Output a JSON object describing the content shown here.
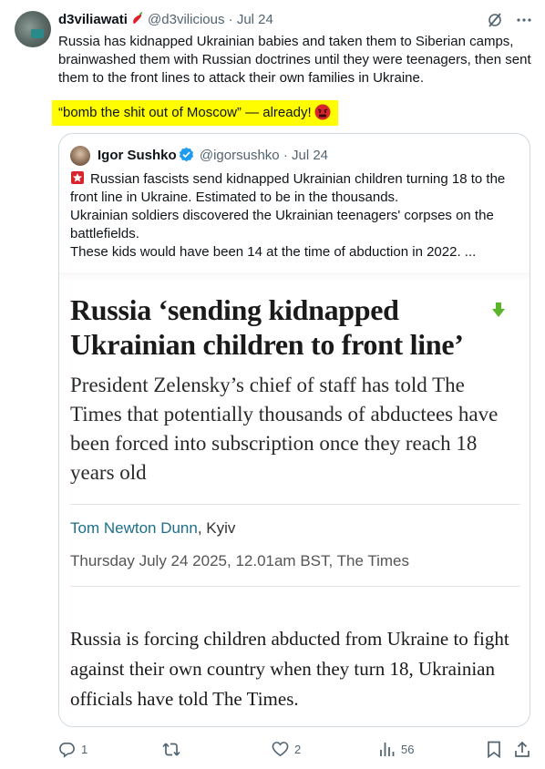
{
  "author": {
    "name": "d3viliawati",
    "handle": "@d3vilicious",
    "separator": "·",
    "time": "Jul 24"
  },
  "tweet": {
    "text": "Russia has kidnapped Ukrainian babies and taken them to Siberian camps, brainwashed them with Russian doctrines until they were teenagers, then sent them to the front lines to attack their own families in Ukraine.",
    "highlight": "“bomb the shit out of Moscow” — already!"
  },
  "quote": {
    "name": "Igor Sushko",
    "handle": "@igorsushko",
    "separator": "·",
    "time": "Jul 24",
    "lines": [
      "Russian fascists send kidnapped Ukrainian children turning 18 to the front line in Ukraine. Estimated to be in the thousands.",
      "Ukrainian soldiers discovered the Ukrainian teenagers' corpses on the battlefields.",
      "These kids would have been 14 at the time of abduction in 2022.  ..."
    ]
  },
  "article": {
    "headline": "Russia ‘sending kidnapped Ukrainian children to front line’",
    "subheadline": "President Zelensky’s chief of staff has told The Times that potentially thousands of abductees have been forced into subscription once they reach 18 years old",
    "author_name": "Tom Newton Dunn",
    "author_location": ", Kyiv",
    "dateline": "Thursday July 24 2025, 12.01am BST, The Times",
    "body": "Russia is forcing children abducted from Ukraine to fight against their own country when they turn 18, Ukrainian officials have told The Times."
  },
  "actions": {
    "replies": "1",
    "reposts": "",
    "likes": "2",
    "views": "56"
  },
  "icons": {
    "grok": "grok-icon",
    "more": "more-icon",
    "reply": "reply-icon",
    "repost": "repost-icon",
    "like": "like-icon",
    "views": "views-icon",
    "bookmark": "bookmark-icon",
    "share": "share-icon"
  },
  "colors": {
    "highlight": "#fffd00",
    "verified": "#1d9bf0",
    "muted": "#536471",
    "author_link": "#1d6f8a"
  }
}
